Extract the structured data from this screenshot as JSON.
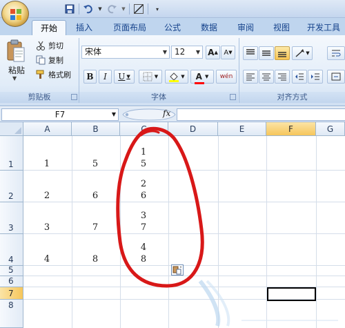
{
  "window": {
    "title": ""
  },
  "tabs": [
    "开始",
    "插入",
    "页面布局",
    "公式",
    "数据",
    "审阅",
    "视图",
    "开发工具"
  ],
  "clipboard": {
    "paste_label": "粘贴",
    "cut_label": "剪切",
    "copy_label": "复制",
    "format_painter_label": "格式刷",
    "group_label": "剪贴板"
  },
  "font": {
    "name": "宋体",
    "size": "12",
    "group_label": "字体",
    "bold": "B",
    "italic": "I",
    "underline": "U",
    "grow": "A",
    "shrink": "A",
    "color_letter": "A",
    "phonetic": "wén\n变"
  },
  "alignment": {
    "group_label": "对齐方式"
  },
  "formula_bar": {
    "name_box": "F7",
    "fx_label": "fx",
    "value": ""
  },
  "columns": [
    "A",
    "B",
    "C",
    "D",
    "E",
    "F",
    "G"
  ],
  "rows": [
    "1",
    "2",
    "3",
    "4",
    "5",
    "6",
    "7",
    "8"
  ],
  "selected_cell": {
    "column": "F",
    "row": "7"
  },
  "cells": {
    "A1": "1",
    "A2": "2",
    "A3": "3",
    "A4": "4",
    "B1": "5",
    "B2": "6",
    "B3": "7",
    "B4": "8",
    "C1": [
      "1",
      "5"
    ],
    "C2": [
      "2",
      "6"
    ],
    "C3": [
      "3",
      "7"
    ],
    "C4": [
      "4",
      "8"
    ]
  },
  "annotation_color": "#d81818",
  "accent_colors": {
    "ribbon_blue": "#bfd5ee",
    "selected_header": "#f6c65b",
    "text_highlight": "#ffff00",
    "font_color": "#ff0000"
  }
}
